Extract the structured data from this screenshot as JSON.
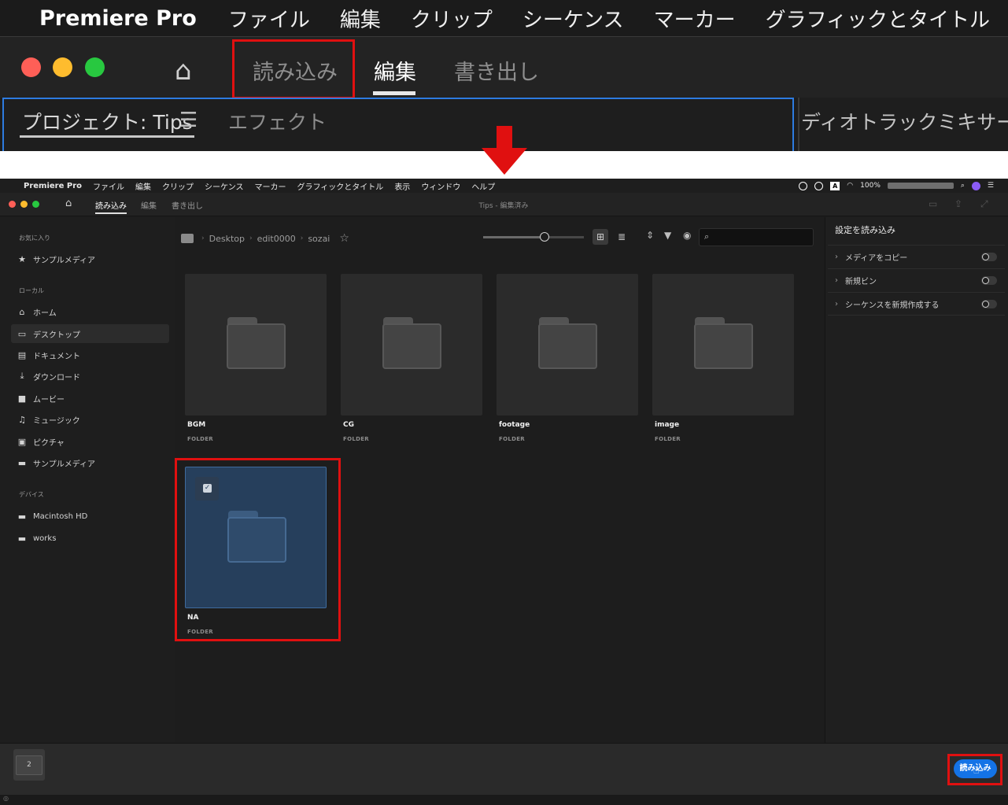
{
  "zoom": {
    "app_name": "Premiere Pro",
    "menu": [
      "ファイル",
      "編集",
      "クリップ",
      "シーケンス",
      "マーカー",
      "グラフィックとタイトル"
    ],
    "tabs": [
      "読み込み",
      "編集",
      "書き出し"
    ],
    "panel_title": "プロジェクト: Tips",
    "panel_tab2": "エフェクト",
    "panel_right": "ディオトラックミキサー: (シ"
  },
  "menubar": {
    "app_name": "Premiere Pro",
    "items": [
      "ファイル",
      "編集",
      "クリップ",
      "シーケンス",
      "マーカー",
      "グラフィックとタイトル",
      "表示",
      "ウィンドウ",
      "ヘルプ"
    ],
    "battery": "100%"
  },
  "app": {
    "tabs": [
      "読み込み",
      "編集",
      "書き出し"
    ],
    "document_title": "Tips - 編集済み"
  },
  "sidebar": {
    "favorites_heading": "お気に入り",
    "favorites": [
      {
        "label": "サンプルメディア",
        "icon": "star-icon"
      }
    ],
    "local_heading": "ローカル",
    "local": [
      {
        "label": "ホーム",
        "icon": "home-icon"
      },
      {
        "label": "デスクトップ",
        "icon": "desktop-icon"
      },
      {
        "label": "ドキュメント",
        "icon": "document-icon"
      },
      {
        "label": "ダウンロード",
        "icon": "download-icon"
      },
      {
        "label": "ムービー",
        "icon": "movie-icon"
      },
      {
        "label": "ミュージック",
        "icon": "music-icon"
      },
      {
        "label": "ピクチャ",
        "icon": "picture-icon"
      },
      {
        "label": "サンプルメディア",
        "icon": "folder-icon"
      }
    ],
    "devices_heading": "デバイス",
    "devices": [
      {
        "label": "Macintosh HD",
        "icon": "folder-icon"
      },
      {
        "label": "works",
        "icon": "folder-icon"
      }
    ]
  },
  "breadcrumb": [
    "Desktop",
    "edit0000",
    "sozai"
  ],
  "folders": [
    {
      "name": "BGM",
      "kind": "FOLDER",
      "selected": false
    },
    {
      "name": "CG",
      "kind": "FOLDER",
      "selected": false
    },
    {
      "name": "footage",
      "kind": "FOLDER",
      "selected": false
    },
    {
      "name": "image",
      "kind": "FOLDER",
      "selected": false
    },
    {
      "name": "NA",
      "kind": "FOLDER",
      "selected": true
    }
  ],
  "import_settings": {
    "title": "設定を読み込み",
    "options": [
      {
        "label": "メディアをコピー",
        "enabled": false
      },
      {
        "label": "新規ビン",
        "enabled": false
      },
      {
        "label": "シーケンスを新規作成する",
        "enabled": false
      }
    ]
  },
  "tray": {
    "count": "2"
  },
  "import_button": "読み込み",
  "colors": {
    "accent": "#1473e6",
    "highlight": "#e01010",
    "selection": "#263f5c"
  }
}
